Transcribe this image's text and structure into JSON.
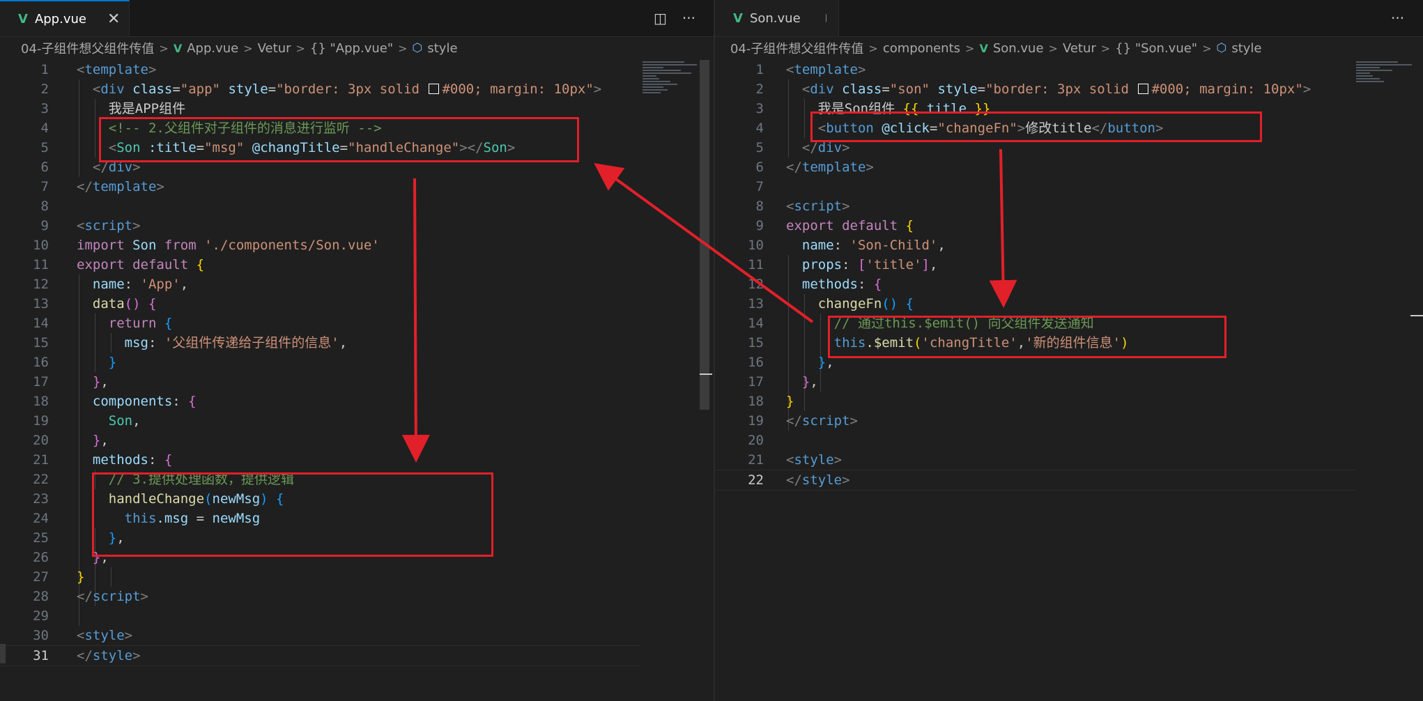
{
  "left": {
    "tab": {
      "label": "App.vue",
      "close": "✕"
    },
    "actions": {
      "split": "◫",
      "more": "···"
    },
    "breadcrumb": [
      "04-子组件想父组件传值",
      "App.vue",
      "Vetur",
      "{} \"App.vue\"",
      "style"
    ],
    "line_numbers": [
      "1",
      "2",
      "3",
      "4",
      "5",
      "6",
      "7",
      "8",
      "9",
      "10",
      "11",
      "12",
      "13",
      "14",
      "15",
      "16",
      "17",
      "18",
      "19",
      "20",
      "21",
      "22",
      "23",
      "24",
      "25",
      "26",
      "27",
      "28",
      "29",
      "30",
      "31"
    ],
    "code": {
      "l1": {
        "o": "<",
        "t": "template",
        "c": ">"
      },
      "l2": {
        "o": "<",
        "t": "div",
        "a1": "class",
        "eq": "=",
        "v1": "\"app\"",
        "a2": "style",
        "v2a": "\"border: 3px solid ",
        "v2b": "#000; margin: 10px\"",
        "c": ">"
      },
      "l3": {
        "text": "我是APP组件"
      },
      "l4": {
        "comment": "<!-- 2.父组件对子组件的消息进行监听 -->"
      },
      "l5": {
        "o": "<",
        "t": "Son",
        "a1": ":title",
        "v1": "\"msg\"",
        "a2": "@changTitle",
        "v2": "\"handleChange\"",
        "c1": "></",
        "t2": "Son",
        "c2": ">"
      },
      "l6": {
        "o": "</",
        "t": "div",
        "c": ">"
      },
      "l7": {
        "o": "</",
        "t": "template",
        "c": ">"
      },
      "l9": {
        "o": "<",
        "t": "script",
        "c": ">"
      },
      "l10": {
        "k1": "import",
        "n": "Son",
        "k2": "from",
        "s": "'./components/Son.vue'"
      },
      "l11": {
        "k1": "export",
        "k2": "default",
        "b": "{"
      },
      "l12": {
        "p": "name",
        "s": "'App'",
        "e": ","
      },
      "l13": {
        "f": "data",
        "pa": "()",
        "b": "{"
      },
      "l14": {
        "k": "return",
        "b": "{"
      },
      "l15": {
        "p": "msg",
        "s": "'父组件传递给子组件的信息'",
        "e": ","
      },
      "l16": {
        "b": "}"
      },
      "l17": {
        "b": "}",
        "e": ","
      },
      "l18": {
        "p": "components",
        "b": "{"
      },
      "l19": {
        "n": "Son",
        "e": ","
      },
      "l20": {
        "b": "}",
        "e": ","
      },
      "l21": {
        "p": "methods",
        "b": "{"
      },
      "l22": {
        "comment": "// 3.提供处理函数，提供逻辑"
      },
      "l23": {
        "f": "handleChange",
        "po": "(",
        "arg": "newMsg",
        "pc": ")",
        "b": "{"
      },
      "l24": {
        "th": "this",
        "p": ".msg",
        "eq": " = ",
        "v": "newMsg"
      },
      "l25": {
        "b": "}",
        "e": ","
      },
      "l26": {
        "b": "}",
        "e": ","
      },
      "l27": {
        "b": "}"
      },
      "l28": {
        "o": "</",
        "t": "script",
        "c": ">"
      },
      "l30": {
        "o": "<",
        "t": "style",
        "c": ">"
      },
      "l31": {
        "o": "</",
        "t": "style",
        "c": ">"
      }
    }
  },
  "right": {
    "tab": {
      "label": "Son.vue"
    },
    "actions": {
      "more": "···"
    },
    "breadcrumb": [
      "04-子组件想父组件传值",
      "components",
      "Son.vue",
      "Vetur",
      "{} \"Son.vue\"",
      "style"
    ],
    "line_numbers": [
      "1",
      "2",
      "3",
      "4",
      "5",
      "6",
      "7",
      "8",
      "9",
      "10",
      "11",
      "12",
      "13",
      "14",
      "15",
      "16",
      "17",
      "18",
      "19",
      "20",
      "21",
      "22"
    ],
    "code": {
      "l1": {
        "o": "<",
        "t": "template",
        "c": ">"
      },
      "l2": {
        "o": "<",
        "t": "div",
        "a1": "class",
        "eq": "=",
        "v1": "\"son\"",
        "a2": "style",
        "v2a": "\"border: 3px solid ",
        "v2b": "#000; margin: 10px\"",
        "c": ">"
      },
      "l3": {
        "text": "我是Son组件 ",
        "mo": "{{",
        "m": " title ",
        "mc": "}}"
      },
      "l4": {
        "o": "<",
        "t": "button",
        "a1": "@click",
        "v1": "\"changeFn\"",
        "c1": ">",
        "text": "修改title",
        "o2": "</",
        "t2": "button",
        "c2": ">"
      },
      "l5": {
        "o": "</",
        "t": "div",
        "c": ">"
      },
      "l6": {
        "o": "</",
        "t": "template",
        "c": ">"
      },
      "l8": {
        "o": "<",
        "t": "script",
        "c": ">"
      },
      "l9": {
        "k1": "export",
        "k2": "default",
        "b": "{"
      },
      "l10": {
        "p": "name",
        "s": "'Son-Child'",
        "e": ","
      },
      "l11": {
        "p": "props",
        "bo": "[",
        "s": "'title'",
        "bc": "]",
        "e": ","
      },
      "l12": {
        "p": "methods",
        "b": "{"
      },
      "l13": {
        "f": "changeFn",
        "pa": "()",
        "b": "{"
      },
      "l14": {
        "comment": "// 通过this.$emit() 向父组件发送通知"
      },
      "l15": {
        "th": "this",
        "f": ".$emit",
        "po": "(",
        "s1": "'changTitle'",
        "cm": ",",
        "s2": "'新的组件信息'",
        "pc": ")"
      },
      "l16": {
        "b": "}",
        "e": ","
      },
      "l17": {
        "b": "}",
        "e": ","
      },
      "l18": {
        "b": "}"
      },
      "l19": {
        "o": "</",
        "t": "script",
        "c": ">"
      },
      "l21": {
        "o": "<",
        "t": "style",
        "c": ">"
      },
      "l22": {
        "o": "</",
        "t": "style",
        "c": ">"
      }
    }
  },
  "colors": {
    "highlight_box": "#e2202a",
    "arrow": "#e2202a",
    "background": "#1f1f1f",
    "active_tab_accent": "#0078d4",
    "vue_green": "#41b883"
  }
}
